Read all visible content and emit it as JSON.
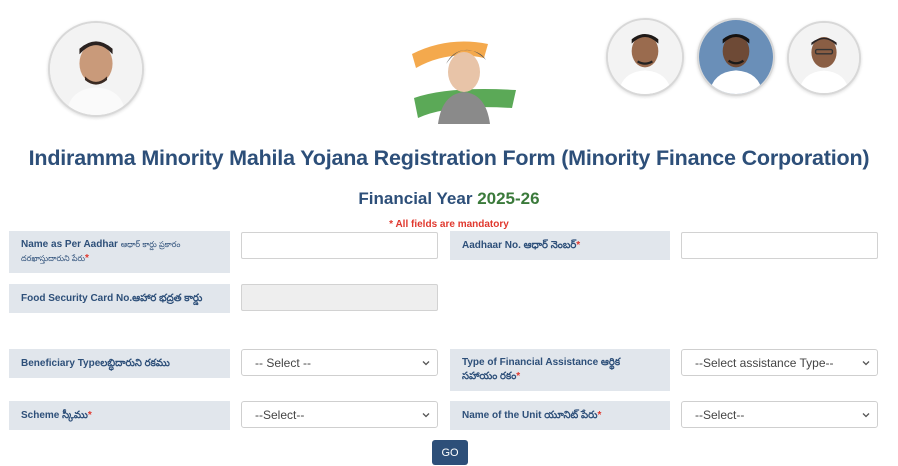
{
  "header": {
    "portraits": [
      "portrait-left",
      "portrait-right-1",
      "portrait-right-2",
      "portrait-right-3"
    ],
    "emblem_icon": "indira-tricolor-emblem-icon"
  },
  "title": "Indiramma Minority Mahila Yojana Registration Form (Minority Finance Corporation)",
  "financial_year": {
    "label": "Financial Year",
    "year": "2025-26"
  },
  "mandatory_note": "* All fields are mandatory",
  "form": {
    "name_label_en": "Name as Per Aadhar ",
    "name_label_te": "ఆధార్ కార్డు ప్రకారం దరఖాస్తుదారుని పేరు",
    "aadhaar_label": "Aadhaar No. ఆధార్ నెంబర్",
    "food_card_label": "Food Security Card No.ఆహార భద్రత కార్డు",
    "beneficiary_type_label": "Beneficiary Typeలబ్ధిదారుని రకము",
    "beneficiary_type_value": "-- Select --",
    "assistance_type_label": "Type of Financial Assistance ఆర్థిక సహాయం రకం",
    "assistance_type_value": "--Select assistance Type--",
    "scheme_label": "Scheme స్కీము",
    "scheme_value": "--Select--",
    "unit_label": "Name of the Unit యూనిట్ పేరు ",
    "unit_value": "--Select--",
    "required_star": "*",
    "go_label": "GO"
  },
  "colors": {
    "primary": "#2d4f79",
    "accent_year": "#3b7a3b",
    "required": "#e0382e",
    "label_bg": "#e1e6ec"
  }
}
